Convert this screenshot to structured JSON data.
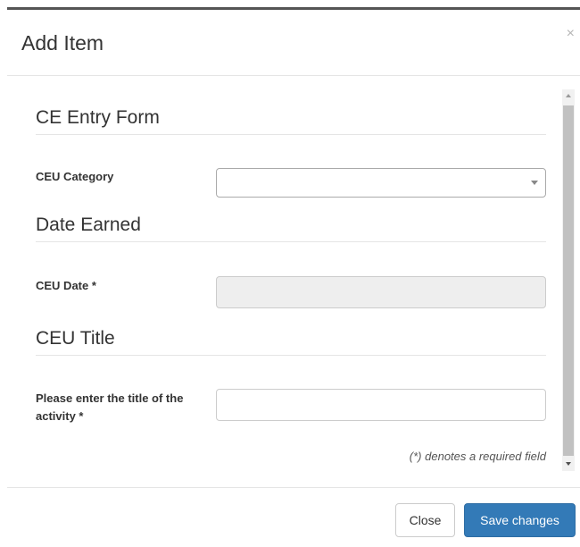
{
  "modal": {
    "title": "Add Item",
    "close_icon": "×"
  },
  "form": {
    "sections": [
      {
        "title": "CE Entry Form"
      },
      {
        "title": "Date Earned"
      },
      {
        "title": "CEU Title"
      }
    ],
    "fields": {
      "category_label": "CEU Category",
      "category_value": "",
      "date_label": "CEU Date *",
      "date_value": "",
      "title_label": "Please enter the title of the activity *",
      "title_value": ""
    },
    "required_note": "(*) denotes a required field"
  },
  "footer": {
    "close_label": "Close",
    "save_label": "Save changes"
  },
  "colors": {
    "primary": "#337ab7",
    "border": "#cccccc",
    "disabled_bg": "#eeeeee"
  },
  "icons": {
    "close": "close-icon",
    "select_caret": "caret-down-icon"
  }
}
